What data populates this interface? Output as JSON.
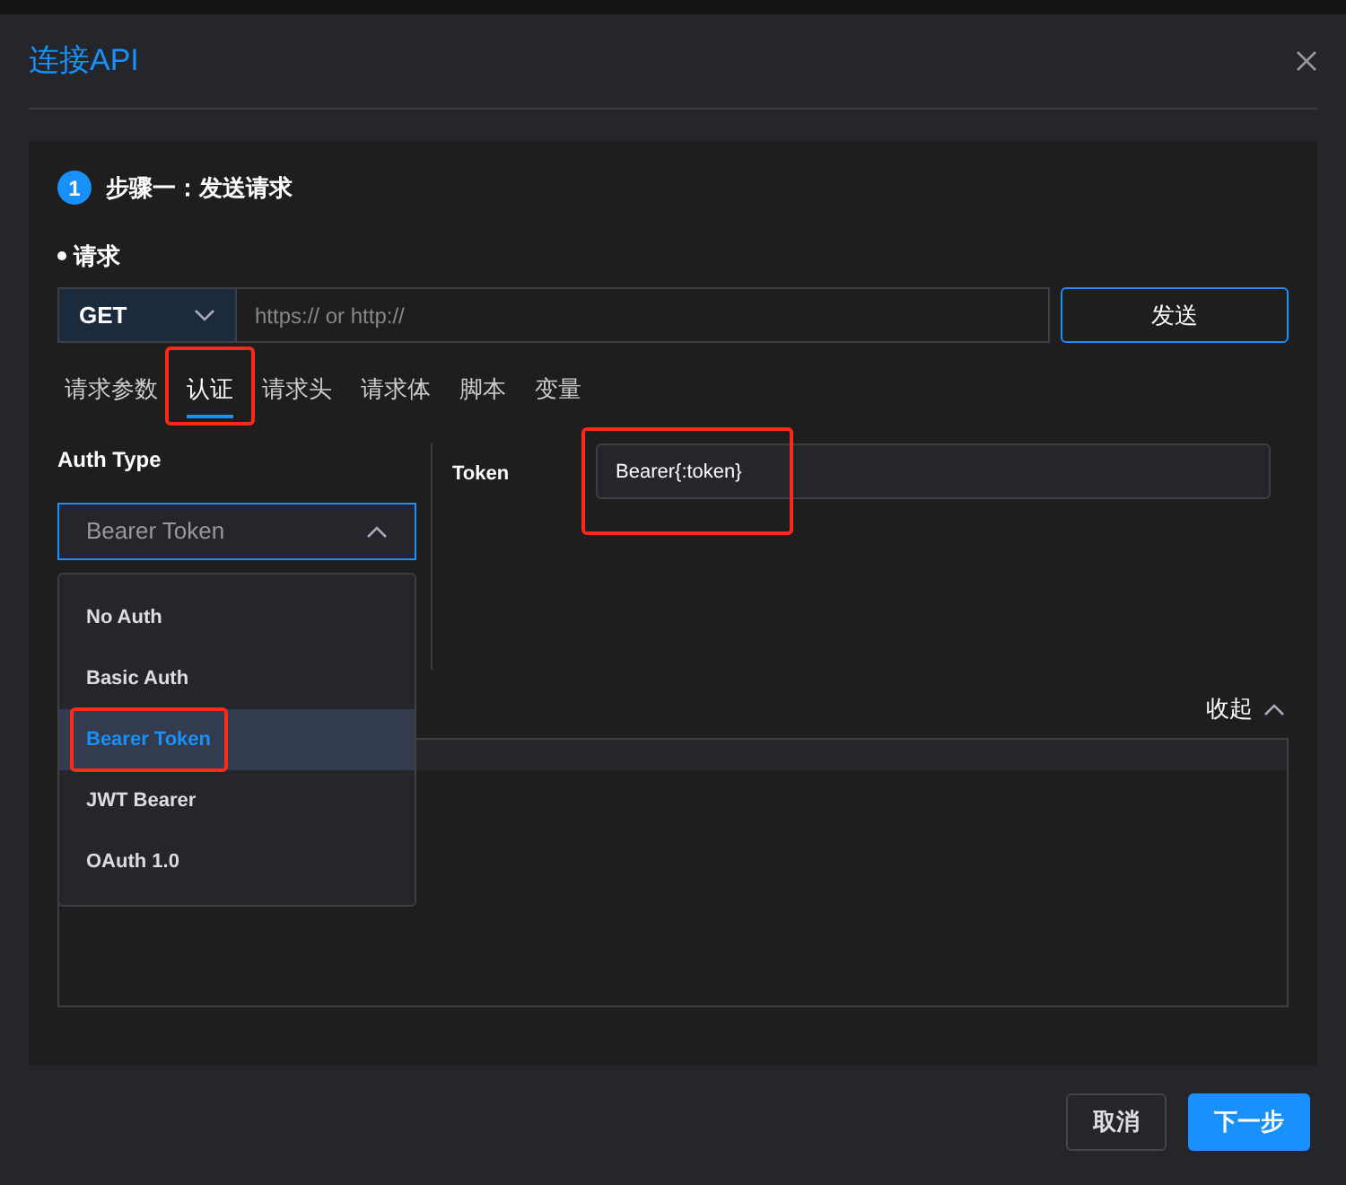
{
  "dialog": {
    "title": "连接API"
  },
  "step": {
    "number": "1",
    "title": "步骤一：发送请求"
  },
  "request": {
    "label": "请求",
    "method": "GET",
    "url_placeholder": "https:// or http://",
    "send": "发送"
  },
  "tabs": [
    {
      "label": "请求参数",
      "selected": false,
      "annotated": false
    },
    {
      "label": "认证",
      "selected": true,
      "annotated": true
    },
    {
      "label": "请求头",
      "selected": false,
      "annotated": false
    },
    {
      "label": "请求体",
      "selected": false,
      "annotated": false
    },
    {
      "label": "脚本",
      "selected": false,
      "annotated": false
    },
    {
      "label": "变量",
      "selected": false,
      "annotated": false
    }
  ],
  "auth": {
    "label": "Auth Type",
    "value": "Bearer Token",
    "expanded": true,
    "options": [
      {
        "label": "No Auth",
        "selected": false,
        "annotated": false
      },
      {
        "label": "Basic Auth",
        "selected": false,
        "annotated": false
      },
      {
        "label": "Bearer Token",
        "selected": true,
        "annotated": true
      },
      {
        "label": "JWT Bearer",
        "selected": false,
        "annotated": false
      },
      {
        "label": "OAuth 1.0",
        "selected": false,
        "annotated": false
      }
    ]
  },
  "token": {
    "label": "Token",
    "value": "Bearer{:token}",
    "annotated": true
  },
  "collapse": "收起",
  "footer": {
    "cancel": "取消",
    "next": "下一步"
  }
}
